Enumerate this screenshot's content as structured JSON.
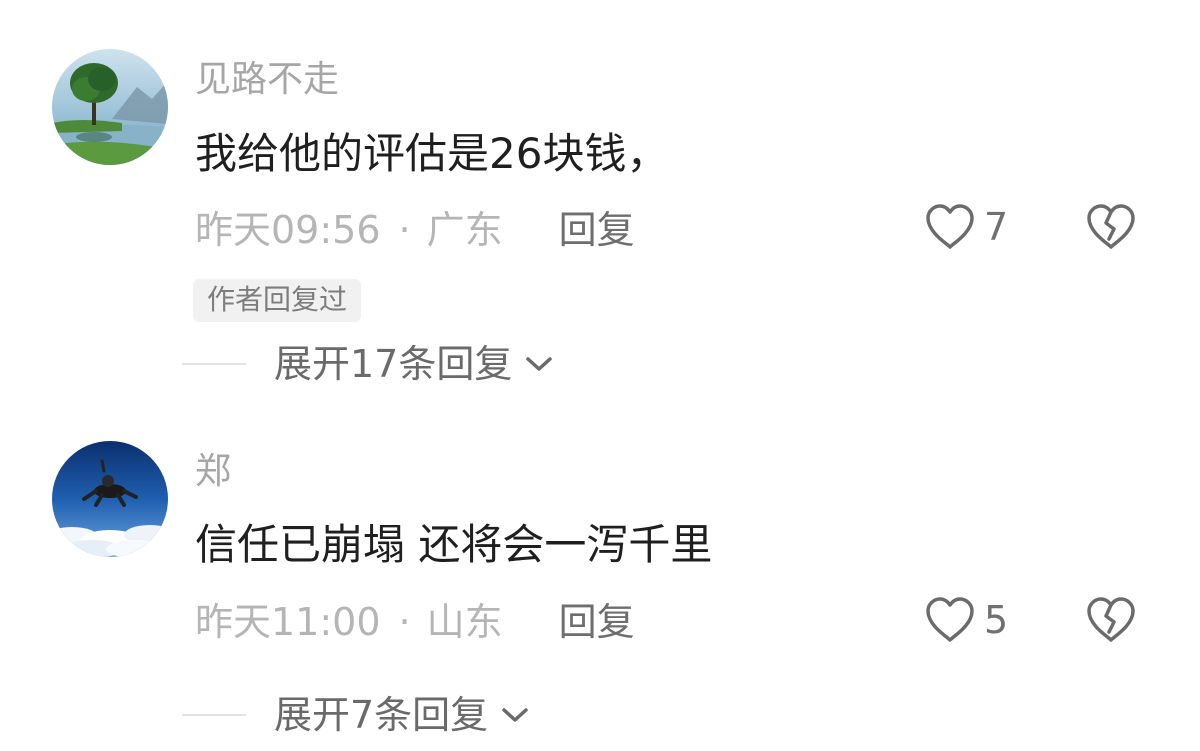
{
  "comments": [
    {
      "avatar_icon": "tree-lake-landscape-icon",
      "username": "见路不走",
      "text": "我给他的评估是26块钱，",
      "time": "昨天09:56",
      "separator": "·",
      "location": "广东",
      "reply_label": "回复",
      "likes": "7",
      "author_replied_label": "作者回复过",
      "expand_label": "展开17条回复"
    },
    {
      "avatar_icon": "skydiver-sky-icon",
      "username": "郑",
      "text": "信任已崩塌 还将会一泻千里",
      "time": "昨天11:00",
      "separator": "·",
      "location": "山东",
      "reply_label": "回复",
      "likes": "5",
      "expand_label": "展开7条回复"
    }
  ],
  "colors": {
    "username": "#a6a6a6",
    "text": "#1f1f1f",
    "meta": "#b5b5b5",
    "icon": "#6b6b6b",
    "badge_bg": "#f1f1f1"
  }
}
